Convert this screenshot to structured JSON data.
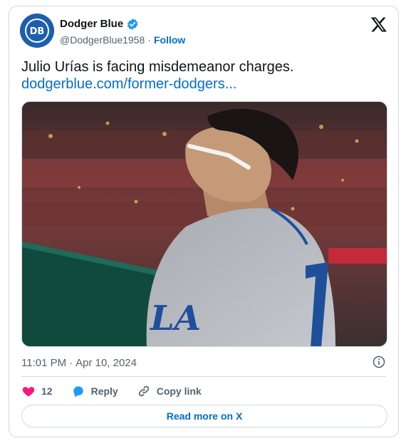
{
  "author": {
    "display_name": "Dodger Blue",
    "handle": "@DodgerBlue1958",
    "separator": "·",
    "follow_label": "Follow",
    "avatar_text": "DB"
  },
  "tweet": {
    "text": "Julio Urías is facing misdemeanor charges.",
    "link_text": "dodgerblue.com/former-dodgers..."
  },
  "meta": {
    "time": "11:01 PM",
    "separator": "·",
    "date": "Apr 10, 2024"
  },
  "actions": {
    "likes_count": "12",
    "reply_label": "Reply",
    "copy_link_label": "Copy link"
  },
  "read_more_label": "Read more on X",
  "colors": {
    "accent": "#006fd6",
    "like": "#f91880",
    "reply": "#1d9bf0",
    "muted": "#536471",
    "border": "#cfd9de"
  },
  "icons": [
    "verified-badge-icon",
    "x-logo-icon",
    "info-icon",
    "heart-icon",
    "reply-bubble-icon",
    "link-icon"
  ]
}
